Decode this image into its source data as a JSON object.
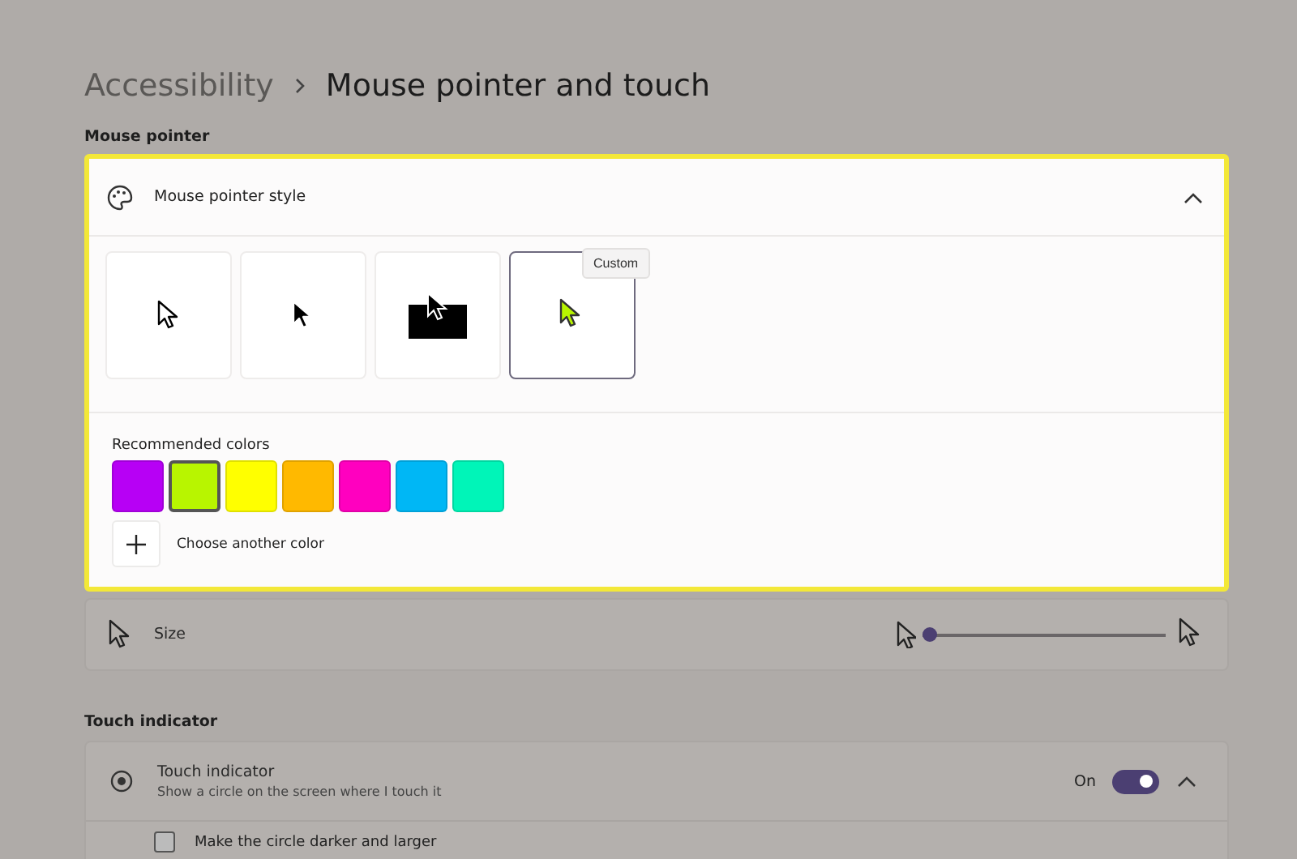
{
  "breadcrumb": {
    "parent": "Accessibility",
    "current": "Mouse pointer and touch"
  },
  "mouse_pointer": {
    "heading": "Mouse pointer",
    "style_card": {
      "title": "Mouse pointer style",
      "expanded": true,
      "styles": [
        {
          "kind": "white",
          "selected": false
        },
        {
          "kind": "black",
          "selected": false
        },
        {
          "kind": "inverted",
          "selected": false
        },
        {
          "kind": "custom",
          "selected": true,
          "tooltip": "Custom"
        }
      ],
      "colors_label": "Recommended colors",
      "colors": [
        {
          "color": "#b700f5",
          "selected": false
        },
        {
          "color": "#b8f500",
          "selected": true
        },
        {
          "color": "#ffff00",
          "selected": false
        },
        {
          "color": "#ffb900",
          "selected": false
        },
        {
          "color": "#ff00bf",
          "selected": false
        },
        {
          "color": "#00b7f5",
          "selected": false
        },
        {
          "color": "#00f5b8",
          "selected": false
        }
      ],
      "choose_label": "Choose another color"
    },
    "size": {
      "label": "Size",
      "level": 0
    }
  },
  "touch": {
    "heading": "Touch indicator",
    "title": "Touch indicator",
    "subtitle": "Show a circle on the screen where I touch it",
    "state_label": "On",
    "on": true,
    "expanded": true,
    "option": {
      "label": "Make the circle darker and larger",
      "checked": false
    }
  }
}
